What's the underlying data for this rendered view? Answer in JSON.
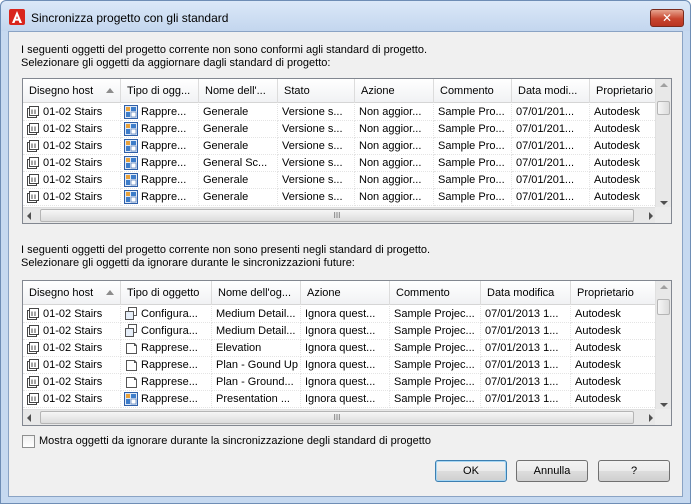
{
  "window": {
    "title": "Sincronizza progetto con gli standard",
    "close_glyph": "✕"
  },
  "top": {
    "description": [
      "I seguenti oggetti del progetto corrente non sono conformi agli standard di progetto.",
      "Selezionare gli oggetti da aggiornare dagli standard di progetto:"
    ],
    "columns": [
      "Disegno host",
      "Tipo di ogg...",
      "Nome dell'...",
      "Stato",
      "Azione",
      "Commento",
      "Data modi...",
      "Proprietario"
    ],
    "rows": [
      [
        "01-02 Stairs",
        "Rappre...",
        "Generale",
        "Versione s...",
        "Non aggior...",
        "Sample Pro...",
        "07/01/201...",
        "Autodesk"
      ],
      [
        "01-02 Stairs",
        "Rappre...",
        "Generale",
        "Versione s...",
        "Non aggior...",
        "Sample Pro...",
        "07/01/201...",
        "Autodesk"
      ],
      [
        "01-02 Stairs",
        "Rappre...",
        "Generale",
        "Versione s...",
        "Non aggior...",
        "Sample Pro...",
        "07/01/201...",
        "Autodesk"
      ],
      [
        "01-02 Stairs",
        "Rappre...",
        "General Sc...",
        "Versione s...",
        "Non aggior...",
        "Sample Pro...",
        "07/01/201...",
        "Autodesk"
      ],
      [
        "01-02 Stairs",
        "Rappre...",
        "Generale",
        "Versione s...",
        "Non aggior...",
        "Sample Pro...",
        "07/01/201...",
        "Autodesk"
      ],
      [
        "01-02 Stairs",
        "Rappre...",
        "Generale",
        "Versione s...",
        "Non aggior...",
        "Sample Pro...",
        "07/01/201...",
        "Autodesk"
      ]
    ],
    "type_icons": [
      "display-rep-icon",
      "display-rep-icon",
      "display-rep-icon",
      "display-rep-icon",
      "display-rep-icon",
      "display-rep-icon"
    ],
    "scroll_grip": "III"
  },
  "bottom": {
    "description": [
      "I seguenti oggetti del progetto corrente non sono presenti negli standard di progetto.",
      "Selezionare gli oggetti da ignorare durante le sincronizzazioni future:"
    ],
    "columns": [
      "Disegno host",
      "Tipo di oggetto",
      "Nome dell'og...",
      "Azione",
      "Commento",
      "Data modifica",
      "Proprietario"
    ],
    "rows": [
      [
        "01-02 Stairs",
        "Configura...",
        "Medium Detail...",
        "Ignora quest...",
        "Sample Projec...",
        "07/01/2013 1...",
        "Autodesk"
      ],
      [
        "01-02 Stairs",
        "Configura...",
        "Medium Detail...",
        "Ignora quest...",
        "Sample Projec...",
        "07/01/2013 1...",
        "Autodesk"
      ],
      [
        "01-02 Stairs",
        "Rapprese...",
        "Elevation",
        "Ignora quest...",
        "Sample Projec...",
        "07/01/2013 1...",
        "Autodesk"
      ],
      [
        "01-02 Stairs",
        "Rapprese...",
        "Plan - Gound Up",
        "Ignora quest...",
        "Sample Projec...",
        "07/01/2013 1...",
        "Autodesk"
      ],
      [
        "01-02 Stairs",
        "Rapprese...",
        "Plan - Ground...",
        "Ignora quest...",
        "Sample Projec...",
        "07/01/2013 1...",
        "Autodesk"
      ],
      [
        "01-02 Stairs",
        "Rapprese...",
        "Presentation ...",
        "Ignora quest...",
        "Sample Projec...",
        "07/01/2013 1...",
        "Autodesk"
      ]
    ],
    "type_icons": [
      "display-config-icon",
      "display-config-icon",
      "display-set-icon",
      "display-set-icon",
      "display-set-icon",
      "display-rep-icon"
    ],
    "scroll_grip": "III"
  },
  "checkbox": {
    "label": "Mostra oggetti da ignorare durante la sincronizzazione degli standard di progetto",
    "checked": false
  },
  "buttons": {
    "ok": "OK",
    "cancel": "Annulla",
    "help": "?"
  },
  "colors": {
    "accent": "#3c7fb1",
    "close": "#c8452e"
  }
}
